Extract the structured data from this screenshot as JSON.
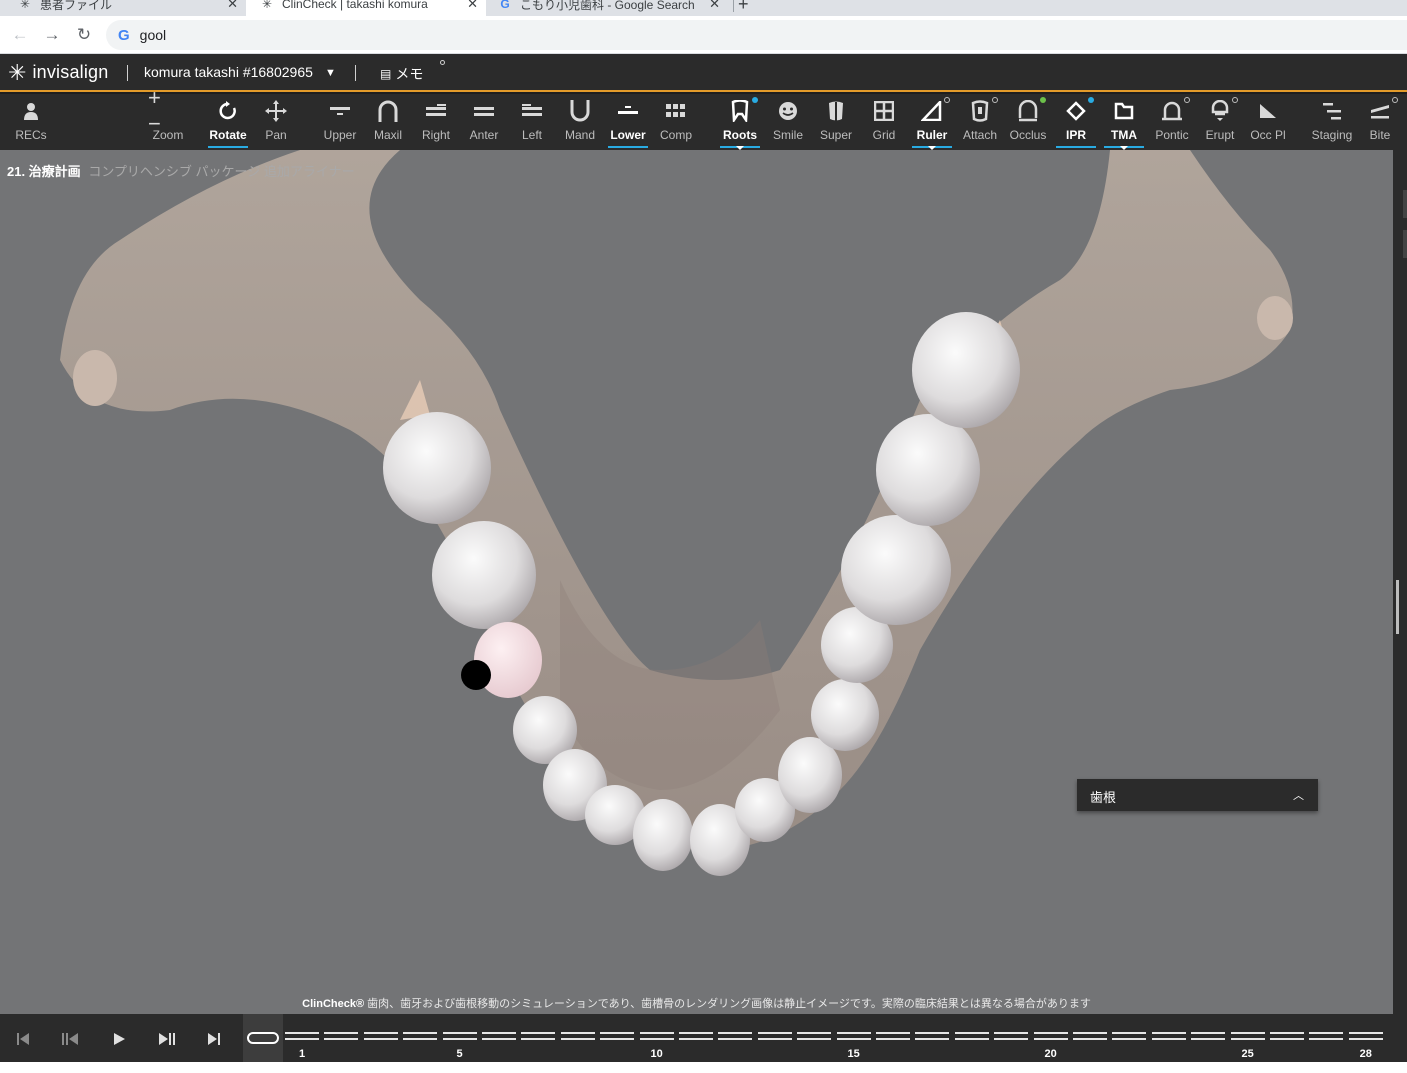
{
  "browser": {
    "tabs": [
      {
        "label": "患者ファイル",
        "active": false
      },
      {
        "label": "ClinCheck | takashi komura",
        "active": true
      },
      {
        "label": "こもり小児歯科 - Google Search",
        "active": false
      }
    ],
    "new_tab": "+",
    "address": "gool"
  },
  "app": {
    "brand": "invisalign",
    "patient": "komura takashi #16802965",
    "memo": "メモ"
  },
  "toolbar": {
    "items": [
      {
        "label": "RECs",
        "icon": "person-icon",
        "on": false
      },
      {
        "label": "Zoom",
        "icon": "zoom-icon",
        "on": false
      },
      {
        "label": "Rotate",
        "icon": "rotate-icon",
        "on": true
      },
      {
        "label": "Pan",
        "icon": "pan-icon",
        "on": false
      },
      {
        "label": "Upper",
        "icon": "upper-view-icon",
        "on": false
      },
      {
        "label": "Maxil",
        "icon": "maxillary-icon",
        "on": false
      },
      {
        "label": "Right",
        "icon": "right-view-icon",
        "on": false
      },
      {
        "label": "Anter",
        "icon": "anterior-view-icon",
        "on": false
      },
      {
        "label": "Left",
        "icon": "left-view-icon",
        "on": false
      },
      {
        "label": "Mand",
        "icon": "mandibular-icon",
        "on": false
      },
      {
        "label": "Lower",
        "icon": "lower-view-icon",
        "on": true
      },
      {
        "label": "Comp",
        "icon": "compare-grid-icon",
        "on": false
      },
      {
        "label": "Roots",
        "icon": "tooth-root-icon",
        "on": true
      },
      {
        "label": "Smile",
        "icon": "smile-face-icon",
        "on": false
      },
      {
        "label": "Super",
        "icon": "superimpose-icon",
        "on": false
      },
      {
        "label": "Grid",
        "icon": "grid-icon",
        "on": false
      },
      {
        "label": "Ruler",
        "icon": "ruler-icon",
        "on": true
      },
      {
        "label": "Attach",
        "icon": "attachment-icon",
        "on": false
      },
      {
        "label": "Occlus",
        "icon": "occlusion-icon",
        "on": false
      },
      {
        "label": "IPR",
        "icon": "ipr-diamond-icon",
        "on": true
      },
      {
        "label": "TMA",
        "icon": "folder-icon",
        "on": true
      },
      {
        "label": "Pontic",
        "icon": "pontic-icon",
        "on": false
      },
      {
        "label": "Erupt",
        "icon": "eruption-icon",
        "on": false
      },
      {
        "label": "Occ Pl",
        "icon": "occlusal-plane-icon",
        "on": false
      },
      {
        "label": "Staging",
        "icon": "staging-icon",
        "on": false
      },
      {
        "label": "Bite",
        "icon": "bite-icon",
        "on": false
      }
    ]
  },
  "viewport": {
    "plan_number": "21. 治療計画",
    "plan_name": "コンプリヘンシブ パッケージ 追加アライナー",
    "roots_panel_title": "歯根",
    "disclaimer_brand": "ClinCheck®",
    "disclaimer_text": " 歯肉、歯牙および歯根移動のシミュレーションであり、歯槽骨のレンダリング画像は静止イメージです。実際の臨床結果とは異なる場合があります"
  },
  "timeline": {
    "current_step": 0,
    "total_steps": 28,
    "labels": [
      "1",
      "5",
      "10",
      "15",
      "20",
      "25",
      "28"
    ],
    "controls": [
      "first-step",
      "previous-step",
      "play",
      "play-pause-step",
      "last-step"
    ]
  },
  "colors": {
    "accent": "#29abe2",
    "header_border": "#e39b2a",
    "toolbar_bg": "#2b2b2b",
    "viewport_bg": "#737476"
  }
}
